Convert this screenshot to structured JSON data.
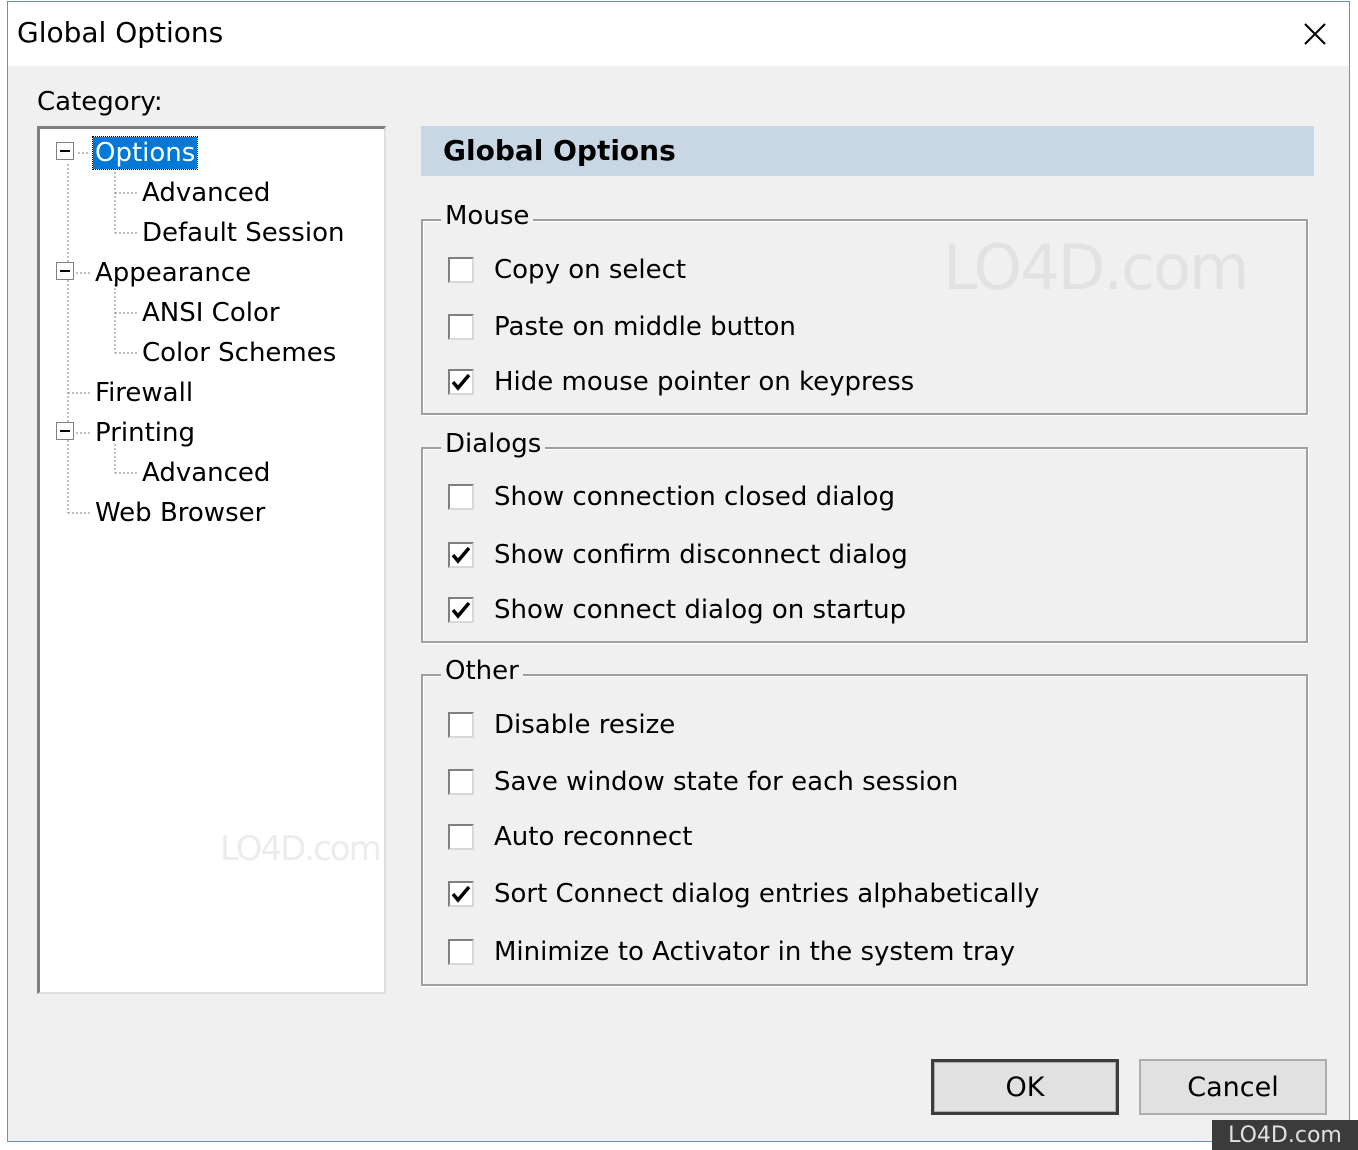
{
  "window": {
    "title": "Global Options"
  },
  "category_label": "Category:",
  "tree": [
    {
      "label": "Options",
      "selected": true
    },
    {
      "label": "Advanced"
    },
    {
      "label": "Default Session"
    },
    {
      "label": "Appearance"
    },
    {
      "label": "ANSI Color"
    },
    {
      "label": "Color Schemes"
    },
    {
      "label": "Firewall"
    },
    {
      "label": "Printing"
    },
    {
      "label": "Advanced"
    },
    {
      "label": "Web Browser"
    }
  ],
  "panel_title": "Global Options",
  "groups": {
    "mouse": {
      "title": "Mouse",
      "items": [
        {
          "label": "Copy on select",
          "checked": false
        },
        {
          "label": "Paste on middle button",
          "checked": false
        },
        {
          "label": "Hide mouse pointer on keypress",
          "checked": true
        }
      ]
    },
    "dialogs": {
      "title": "Dialogs",
      "items": [
        {
          "label": "Show connection closed dialog",
          "checked": false
        },
        {
          "label": "Show confirm disconnect dialog",
          "checked": true
        },
        {
          "label": "Show connect dialog on startup",
          "checked": true
        }
      ]
    },
    "other": {
      "title": "Other",
      "items": [
        {
          "label": "Disable resize",
          "checked": false
        },
        {
          "label": "Save window state for each session",
          "checked": false
        },
        {
          "label": "Auto reconnect",
          "checked": false
        },
        {
          "label": "Sort Connect dialog entries alphabetically",
          "checked": true
        },
        {
          "label": "Minimize to Activator in the system tray",
          "checked": false
        }
      ]
    }
  },
  "buttons": {
    "ok": "OK",
    "cancel": "Cancel"
  },
  "watermark": {
    "main": "LO4D.com",
    "small": "LO4D.com",
    "corner": "LO4D.com"
  },
  "colors": {
    "selection": "#0078d7",
    "header_bg": "#c9d6e3",
    "dialog_bg": "#f0f0f0"
  },
  "icons": {
    "close": "close-icon",
    "expand": "minus-box-icon",
    "check": "checkmark-icon"
  }
}
